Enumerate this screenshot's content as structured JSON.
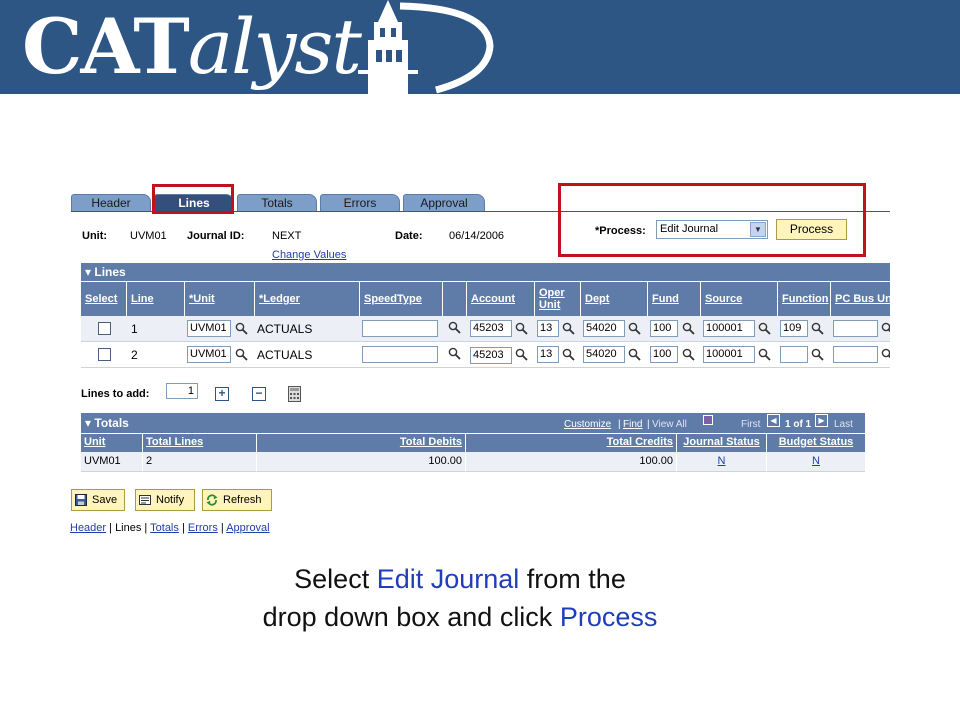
{
  "banner": {
    "logo_cap": "CAT",
    "logo_rest": "alyst",
    "bg_color": "#2e5684"
  },
  "tabs": [
    {
      "label": "Header",
      "active": false
    },
    {
      "label": "Lines",
      "active": true
    },
    {
      "label": "Totals",
      "active": false
    },
    {
      "label": "Errors",
      "active": false
    },
    {
      "label": "Approval",
      "active": false
    }
  ],
  "header": {
    "unit_label": "Unit:",
    "unit_value": "UVM01",
    "journal_label": "Journal ID:",
    "journal_value": "NEXT",
    "date_label": "Date:",
    "date_value": "06/14/2006",
    "change_values": "Change Values"
  },
  "process": {
    "label": "*Process:",
    "selected": "Edit Journal",
    "button": "Process"
  },
  "lines_grid": {
    "title": "Lines",
    "columns": [
      "Select",
      "Line",
      "*Unit",
      "*Ledger",
      "SpeedType",
      "",
      "Account",
      "Oper Unit",
      "Dept",
      "Fund",
      "Source",
      "Function",
      "PC Bus Un"
    ],
    "rows": [
      {
        "line": "1",
        "unit": "UVM01",
        "ledger": "ACTUALS",
        "speedtype": "",
        "account": "45203",
        "oper": "13",
        "dept": "54020",
        "fund": "100",
        "source": "100001",
        "function": "109",
        "pcbus": ""
      },
      {
        "line": "2",
        "unit": "UVM01",
        "ledger": "ACTUALS",
        "speedtype": "",
        "account": "45203",
        "oper": "13",
        "dept": "54020",
        "fund": "100",
        "source": "100001",
        "function": "",
        "pcbus": ""
      }
    ]
  },
  "lines_to_add": {
    "label": "Lines to add:",
    "value": "1",
    "plus": "+",
    "minus": "−"
  },
  "totals_grid": {
    "title": "Totals",
    "nav": {
      "customize": "Customize",
      "sep": "|",
      "find": "Find",
      "view_all": "View All",
      "first": "First",
      "range": "1 of 1",
      "last": "Last"
    },
    "columns": [
      "Unit",
      "Total Lines",
      "Total Debits",
      "Total Credits",
      "Journal Status",
      "Budget Status"
    ],
    "row": {
      "unit": "UVM01",
      "lines": "2",
      "debits": "100.00",
      "credits": "100.00",
      "journal_status": "N",
      "budget_status": "N"
    }
  },
  "buttons": {
    "save": "Save",
    "notify": "Notify",
    "refresh": "Refresh"
  },
  "bottom_links": {
    "header": "Header",
    "lines": "Lines",
    "totals": "Totals",
    "errors": "Errors",
    "approval": "Approval",
    "sep": " | "
  },
  "caption": {
    "l1_a": "Select ",
    "l1_b": "Edit Journal",
    "l1_c": " from the",
    "l2_a": "drop down box and click ",
    "l2_b": "Process"
  },
  "colors": {
    "grid_header": "#5f7ca9",
    "highlight": "#c0121c",
    "button_bg": "#fff4bb",
    "link": "#1f3fa8"
  }
}
